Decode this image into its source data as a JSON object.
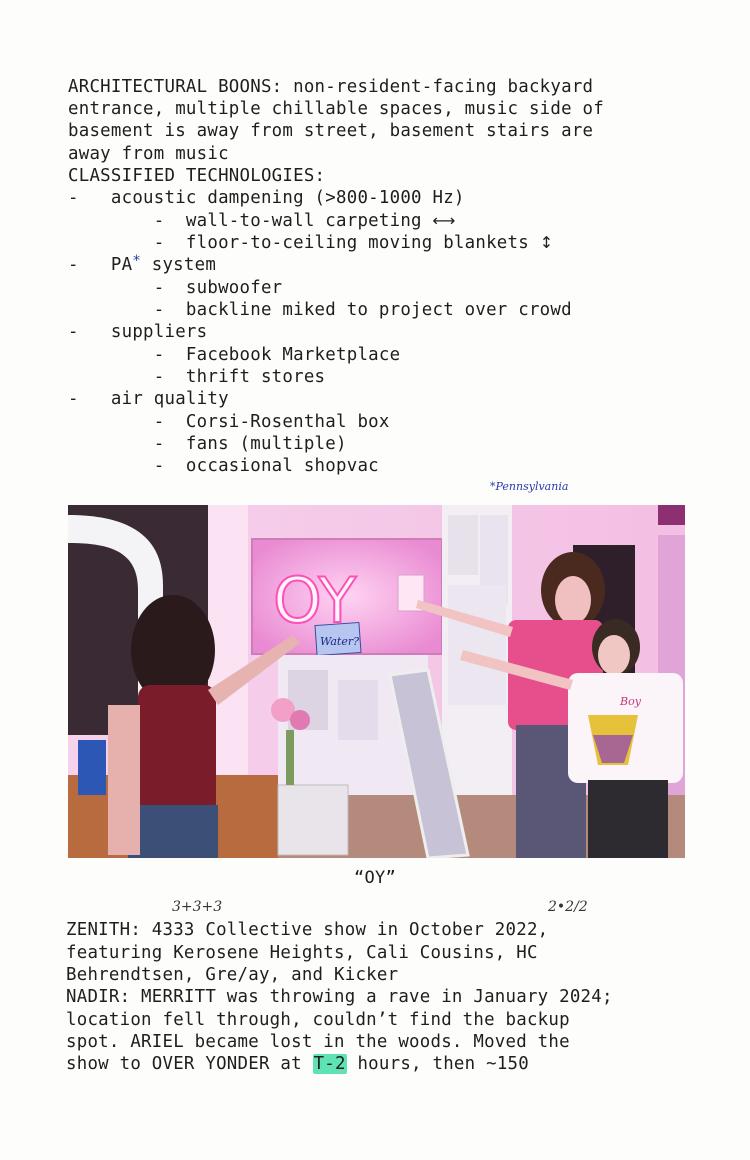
{
  "page": {
    "intro_lines": [
      "ARCHITECTURAL BOONS: non-resident-facing backyard",
      "entrance, multiple chillable spaces, music side of",
      "basement is away from street, basement stairs are",
      "away from music",
      "CLASSIFIED TECHNOLOGIES:"
    ],
    "list": [
      {
        "text": "-   acoustic dampening (>800-1000 Hz)"
      },
      {
        "text": "        -  wall-to-wall carpeting ",
        "arrow": "⟷"
      },
      {
        "text": "        -  floor-to-ceiling moving blankets ",
        "arrow": "↕"
      },
      {
        "text": "-   PA",
        "star": "*",
        "rest": " system"
      },
      {
        "text": "        -  subwoofer"
      },
      {
        "text": "        -  backline miked to project over crowd"
      },
      {
        "text": "-   suppliers"
      },
      {
        "text": "        -  Facebook Marketplace"
      },
      {
        "text": "        -  thrift stores"
      },
      {
        "text": "-   air quality"
      },
      {
        "text": "        -  Corsi-Rosenthal box"
      },
      {
        "text": "        -  fans (multiple)"
      },
      {
        "text": "        -  occasional shopvac"
      }
    ],
    "handwritten_note": "*Pennsylvania",
    "photo": {
      "neon_text": "OY",
      "sign_text": "Water?",
      "shirt_text": "Boy"
    },
    "caption": "“OY”",
    "annotations": {
      "above_4333": "3+3+3",
      "above_2022": "2•2/2"
    },
    "outro": {
      "zenith_line1": "ZENITH: 4333 Collective show in October 2022,",
      "zenith_line2": "featuring Kerosene Heights, Cali Cousins, HC",
      "zenith_line3": "Behrendtsen, Gre/ay, and Kicker",
      "nadir_line1": "NADIR: MERRITT was throwing a rave in January 2024;",
      "nadir_line2": "location fell through, couldn’t find the backup",
      "nadir_line3": "spot. ARIEL became lost in the woods. Moved the",
      "nadir_line4_pre": "show to OVER YONDER at ",
      "nadir_line4_hl": "T-2",
      "nadir_line4_post": " hours, then ~150"
    }
  }
}
